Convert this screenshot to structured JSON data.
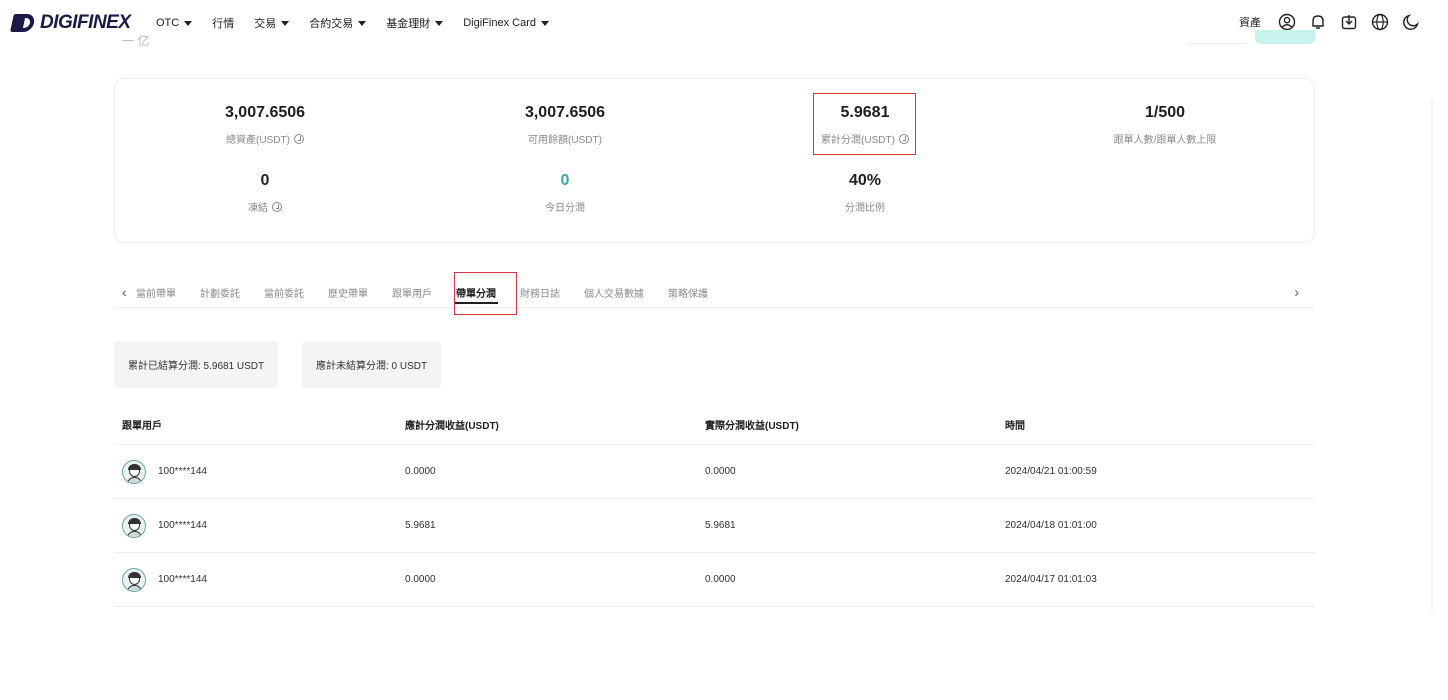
{
  "header": {
    "logo_text": "DIGIFINEX",
    "nav": [
      {
        "label": "OTC",
        "dropdown": true
      },
      {
        "label": "行情",
        "dropdown": false
      },
      {
        "label": "交易",
        "dropdown": true
      },
      {
        "label": "合約交易",
        "dropdown": true
      },
      {
        "label": "基金理財",
        "dropdown": true
      },
      {
        "label": "DigiFinex Card",
        "dropdown": true
      }
    ],
    "assets_label": "資產",
    "icons": [
      "user-icon",
      "bell-icon",
      "download-icon",
      "globe-icon",
      "moon-icon"
    ]
  },
  "ghost_label": "一 亿",
  "stats": {
    "total_assets": {
      "value": "3,007.6506",
      "label": "總資產(USDT)"
    },
    "available": {
      "value": "3,007.6506",
      "label": "可用餘額(USDT)"
    },
    "cumulative_share": {
      "value": "5.9681",
      "label": "累計分潤(USDT)"
    },
    "followers": {
      "value": "1/500",
      "label": "跟單人數/跟單人數上限"
    },
    "frozen": {
      "value": "0",
      "label": "凍結"
    },
    "today_share": {
      "value": "0",
      "label": "今日分潤"
    },
    "share_ratio": {
      "value": "40%",
      "label": "分潤比例"
    }
  },
  "tabs": {
    "items": [
      "當前帶單",
      "計劃委託",
      "當前委託",
      "歷史帶單",
      "跟單用戶",
      "帶單分潤",
      "財務日誌",
      "個人交易數據",
      "策略保護"
    ],
    "active": "帶單分潤"
  },
  "summary": {
    "settled": "累計已結算分潤: 5.9681 USDT",
    "unsettled": "應計未結算分潤: 0 USDT"
  },
  "table": {
    "columns": [
      "跟單用戶",
      "應計分潤收益(USDT)",
      "實際分潤收益(USDT)",
      "時間"
    ],
    "rows": [
      {
        "user": "100****144",
        "accrued": "0.0000",
        "actual": "0.0000",
        "time": "2024/04/21 01:00:59"
      },
      {
        "user": "100****144",
        "accrued": "5.9681",
        "actual": "5.9681",
        "time": "2024/04/18 01:01:00"
      },
      {
        "user": "100****144",
        "accrued": "0.0000",
        "actual": "0.0000",
        "time": "2024/04/17 01:01:03"
      }
    ]
  },
  "colors": {
    "accent": "#3aa9a0",
    "highlight": "#d9393e",
    "brand": "#1a1a4a"
  }
}
